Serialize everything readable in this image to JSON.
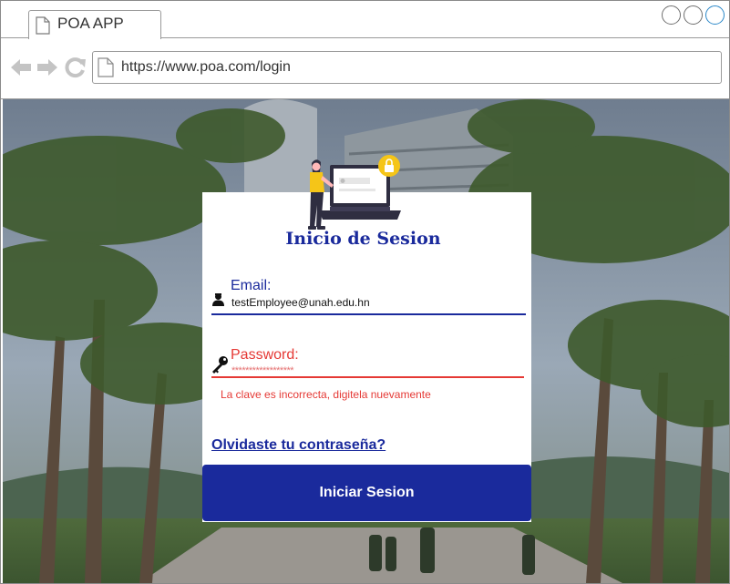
{
  "browser": {
    "tab_title": "POA APP",
    "url": "https://www.poa.com/login",
    "icons": [
      "back-arrow-icon",
      "forward-arrow-icon",
      "reload-icon",
      "document-icon"
    ]
  },
  "login": {
    "title": "Inicio de Sesion",
    "email_label": "Email:",
    "email_value": "testEmployee@unah.edu.hn",
    "password_label": "Password:",
    "password_value": "******************",
    "error_message": "La clave es incorrecta, digitela nuevamente",
    "forgot_password": "Olvidaste tu contraseña?",
    "submit_label": "Iniciar Sesion"
  },
  "colors": {
    "primary": "#1a2a9c",
    "error": "#e53935",
    "illustration_accent": "#f5c518"
  }
}
